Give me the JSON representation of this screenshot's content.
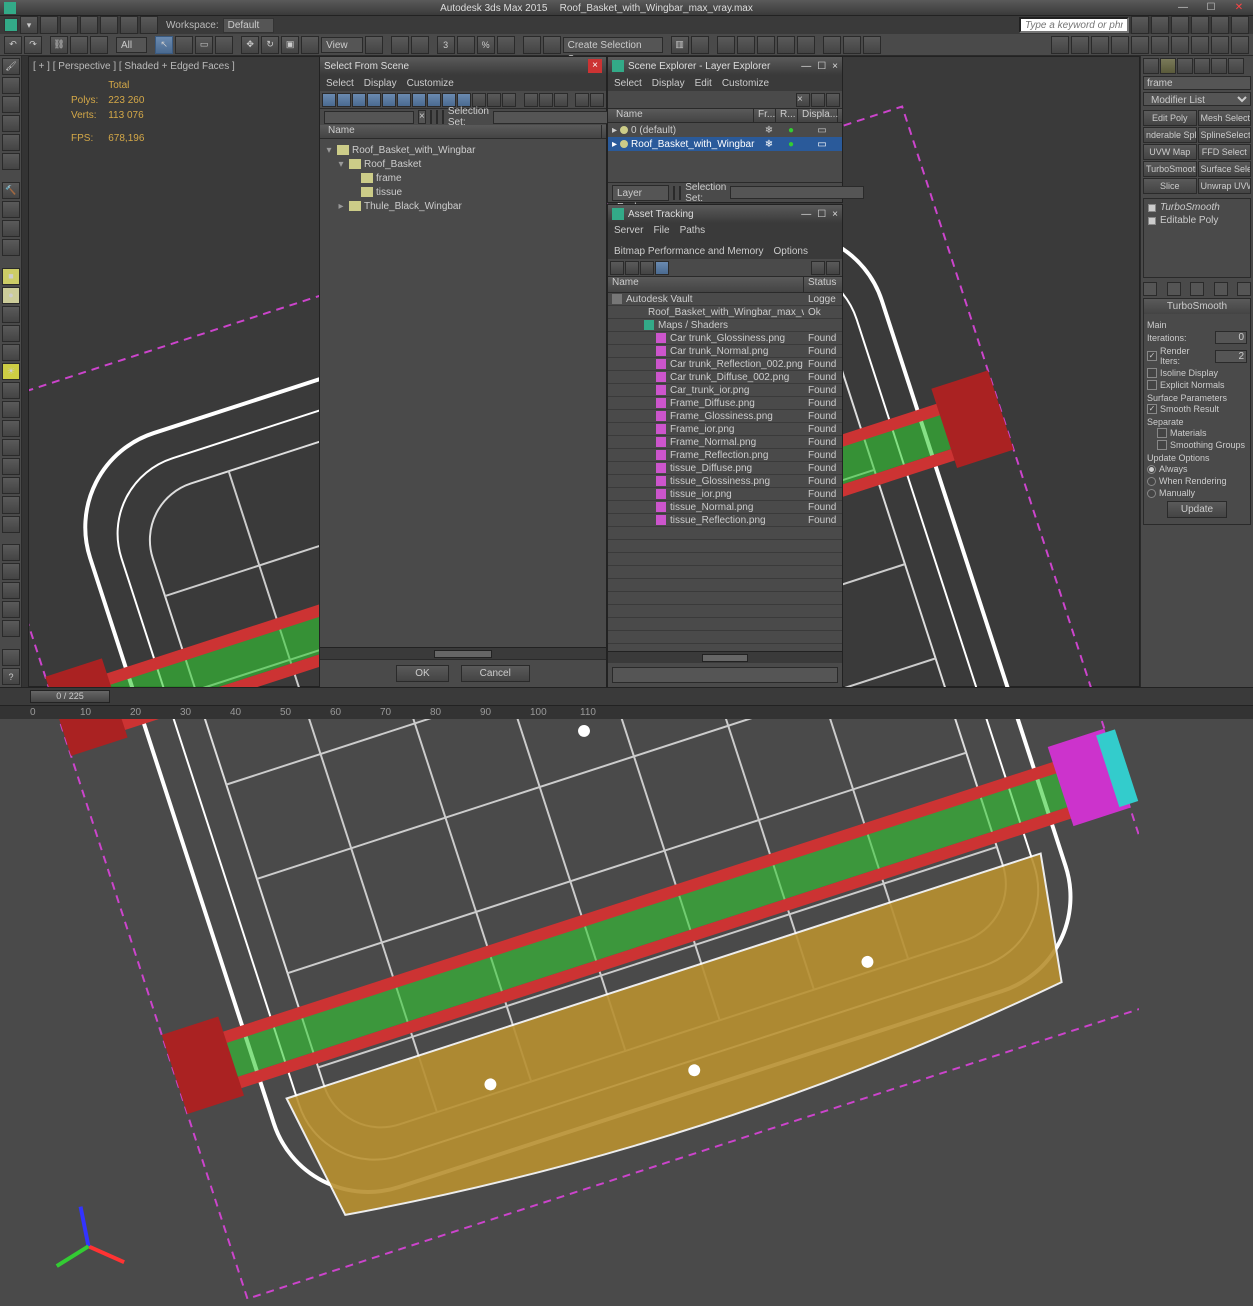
{
  "app": {
    "title_left": "Autodesk 3ds Max 2015",
    "title_file": "Roof_Basket_with_Wingbar_max_vray.max",
    "workspace_label": "Workspace:",
    "workspace_value": "Default",
    "search_placeholder": "Type a keyword or phrase"
  },
  "toolbar": {
    "all_dropdown": "All",
    "create_sel": "Create Selection Se"
  },
  "viewport": {
    "label": "[ + ] [ Perspective ] [ Shaded + Edged Faces ]",
    "stats": {
      "total_label": "Total",
      "polys_label": "Polys:",
      "polys": "223 260",
      "verts_label": "Verts:",
      "verts": "113 076",
      "fps_label": "FPS:",
      "fps": "678,196"
    }
  },
  "select_from_scene": {
    "title": "Select From Scene",
    "menus": [
      "Select",
      "Display",
      "Customize"
    ],
    "name_col": "Name",
    "selset": "Selection Set:",
    "tree": [
      {
        "depth": 0,
        "label": "Roof_Basket_with_Wingbar",
        "expanded": true
      },
      {
        "depth": 1,
        "label": "Roof_Basket",
        "expanded": true
      },
      {
        "depth": 2,
        "label": "frame"
      },
      {
        "depth": 2,
        "label": "tissue"
      },
      {
        "depth": 1,
        "label": "Thule_Black_Wingbar",
        "expanded": false
      }
    ],
    "ok": "OK",
    "cancel": "Cancel"
  },
  "scene_explorer": {
    "title": "Scene Explorer - Layer Explorer",
    "menus": [
      "Select",
      "Display",
      "Edit",
      "Customize"
    ],
    "cols": {
      "name": "Name",
      "fr": "Fr...",
      "r": "R...",
      "disp": "Displa..."
    },
    "rows": [
      {
        "label": "0 (default)",
        "selected": false
      },
      {
        "label": "Roof_Basket_with_Wingbar",
        "selected": true
      }
    ],
    "footer_label": "Layer Explorer",
    "footer_selset": "Selection Set:"
  },
  "asset_tracking": {
    "title": "Asset Tracking",
    "menus": [
      "Server",
      "File",
      "Paths",
      "Bitmap Performance and Memory",
      "Options"
    ],
    "cols": {
      "name": "Name",
      "status": "Status"
    },
    "rows": [
      {
        "label": "Autodesk Vault",
        "status": "Logge",
        "indent": 0,
        "icon": "#777"
      },
      {
        "label": "Roof_Basket_with_Wingbar_max_vray.max",
        "status": "Ok",
        "indent": 1,
        "icon": "#3a8"
      },
      {
        "label": "Maps / Shaders",
        "status": "",
        "indent": 1,
        "icon": "#3a8"
      },
      {
        "label": "Car trunk_Glossiness.png",
        "status": "Found",
        "indent": 2,
        "icon": "#c5c"
      },
      {
        "label": "Car trunk_Normal.png",
        "status": "Found",
        "indent": 2,
        "icon": "#c5c"
      },
      {
        "label": "Car trunk_Reflection_002.png",
        "status": "Found",
        "indent": 2,
        "icon": "#c5c"
      },
      {
        "label": "Car trunk_Diffuse_002.png",
        "status": "Found",
        "indent": 2,
        "icon": "#c5c"
      },
      {
        "label": "Car_trunk_ior.png",
        "status": "Found",
        "indent": 2,
        "icon": "#c5c"
      },
      {
        "label": "Frame_Diffuse.png",
        "status": "Found",
        "indent": 2,
        "icon": "#c5c"
      },
      {
        "label": "Frame_Glossiness.png",
        "status": "Found",
        "indent": 2,
        "icon": "#c5c"
      },
      {
        "label": "Frame_ior.png",
        "status": "Found",
        "indent": 2,
        "icon": "#c5c"
      },
      {
        "label": "Frame_Normal.png",
        "status": "Found",
        "indent": 2,
        "icon": "#c5c"
      },
      {
        "label": "Frame_Reflection.png",
        "status": "Found",
        "indent": 2,
        "icon": "#c5c"
      },
      {
        "label": "tissue_Diffuse.png",
        "status": "Found",
        "indent": 2,
        "icon": "#c5c"
      },
      {
        "label": "tissue_Glossiness.png",
        "status": "Found",
        "indent": 2,
        "icon": "#c5c"
      },
      {
        "label": "tissue_ior.png",
        "status": "Found",
        "indent": 2,
        "icon": "#c5c"
      },
      {
        "label": "tissue_Normal.png",
        "status": "Found",
        "indent": 2,
        "icon": "#c5c"
      },
      {
        "label": "tissue_Reflection.png",
        "status": "Found",
        "indent": 2,
        "icon": "#c5c"
      }
    ]
  },
  "modify_panel": {
    "object_name": "frame",
    "modifier_list": "Modifier List",
    "buttons": [
      "Edit Poly",
      "Mesh Select",
      "nderable Spli",
      "SplineSelect",
      "UVW Map",
      "FFD Select",
      "TurboSmooth",
      "Surface Select",
      "Slice",
      "Unwrap UVW"
    ],
    "stack": [
      {
        "label": "TurboSmooth",
        "italic": true,
        "checked": true
      },
      {
        "label": "Editable Poly",
        "italic": false,
        "checked": true
      }
    ],
    "rollout_title": "TurboSmooth",
    "main_label": "Main",
    "iterations_label": "Iterations:",
    "iterations_value": "0",
    "render_iters_label": "Render Iters:",
    "render_iters_value": "2",
    "render_iters_checked": true,
    "isoline": "Isoline Display",
    "explicit": "Explicit Normals",
    "surface_params": "Surface Parameters",
    "smooth_result": "Smooth Result",
    "smooth_result_checked": true,
    "separate": "Separate",
    "materials": "Materials",
    "smoothing_groups": "Smoothing Groups",
    "update_options": "Update Options",
    "always": "Always",
    "when_rendering": "When Rendering",
    "manually": "Manually",
    "update_btn": "Update"
  },
  "timeline": {
    "slider": "0 / 225",
    "ticks": [
      "0",
      "10",
      "20",
      "30",
      "40",
      "50",
      "60",
      "70",
      "80",
      "90",
      "100",
      "110"
    ]
  }
}
